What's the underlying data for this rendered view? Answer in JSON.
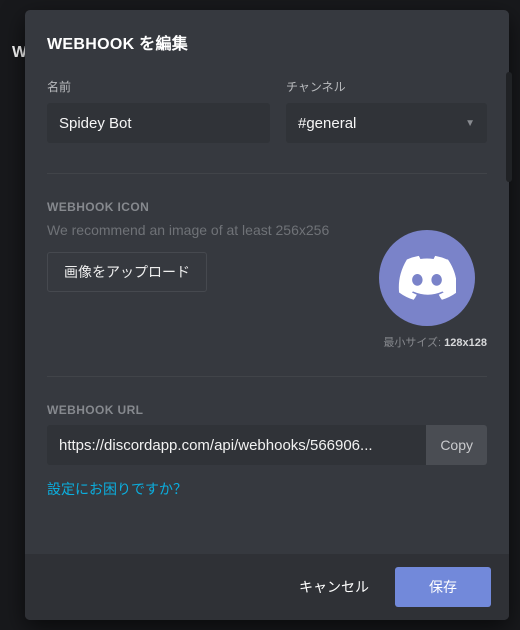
{
  "backdrop": {
    "partial_heading": "W"
  },
  "modal": {
    "title": "WEBHOOK を編集",
    "name": {
      "label": "名前",
      "value": "Spidey Bot"
    },
    "channel": {
      "label": "チャンネル",
      "selected": "#general"
    },
    "icon_section": {
      "heading": "WEBHOOK ICON",
      "hint": "We recommend an image of at least 256x256",
      "upload_label": "画像をアップロード",
      "min_size_prefix": "最小サイズ: ",
      "min_size_value": "128x128"
    },
    "url_section": {
      "heading": "WEBHOOK URL",
      "value": "https://discordapp.com/api/webhooks/566906...",
      "copy_label": "Copy"
    },
    "help_link": "設定にお困りですか？",
    "footer": {
      "cancel": "キャンセル",
      "save": "保存"
    }
  },
  "colors": {
    "accent": "#7289da",
    "avatar_bg": "#7a83c9",
    "link": "#0baede"
  }
}
